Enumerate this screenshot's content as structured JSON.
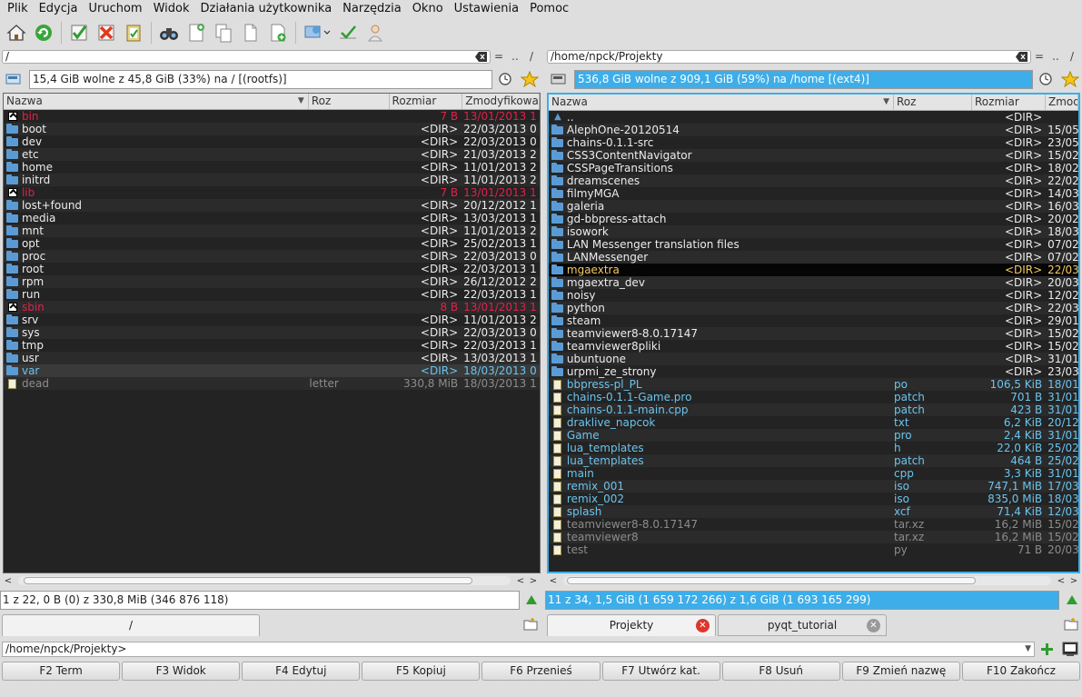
{
  "menu": [
    "Plik",
    "Edycja",
    "Uruchom",
    "Widok",
    "Działania użytkownika",
    "Narzędzia",
    "Okno",
    "Ustawienia",
    "Pomoc"
  ],
  "left": {
    "path": "/",
    "nav_up": "..",
    "nav_root": "/",
    "eq": "=",
    "info": "15,4 GiB wolne z 45,8 GiB (33%) na / [(rootfs)]",
    "headers": {
      "name": "Nazwa",
      "ext": "Roz",
      "size": "Rozmiar",
      "date": "Zmodyfikowa"
    },
    "rows": [
      {
        "name": "bin",
        "ext": "",
        "size": "7 B",
        "date": "13/01/2013 1",
        "kind": "link"
      },
      {
        "name": "boot",
        "ext": "",
        "size": "<DIR>",
        "date": "22/03/2013 0",
        "kind": "dir"
      },
      {
        "name": "dev",
        "ext": "",
        "size": "<DIR>",
        "date": "22/03/2013 0",
        "kind": "dir"
      },
      {
        "name": "etc",
        "ext": "",
        "size": "<DIR>",
        "date": "21/03/2013 2",
        "kind": "dir"
      },
      {
        "name": "home",
        "ext": "",
        "size": "<DIR>",
        "date": "11/01/2013 2",
        "kind": "dir"
      },
      {
        "name": "initrd",
        "ext": "",
        "size": "<DIR>",
        "date": "11/01/2013 2",
        "kind": "dir"
      },
      {
        "name": "lib",
        "ext": "",
        "size": "7 B",
        "date": "13/01/2013 1",
        "kind": "link"
      },
      {
        "name": "lost+found",
        "ext": "",
        "size": "<DIR>",
        "date": "20/12/2012 1",
        "kind": "dir"
      },
      {
        "name": "media",
        "ext": "",
        "size": "<DIR>",
        "date": "13/03/2013 1",
        "kind": "dir"
      },
      {
        "name": "mnt",
        "ext": "",
        "size": "<DIR>",
        "date": "11/01/2013 2",
        "kind": "dir"
      },
      {
        "name": "opt",
        "ext": "",
        "size": "<DIR>",
        "date": "25/02/2013 1",
        "kind": "dir"
      },
      {
        "name": "proc",
        "ext": "",
        "size": "<DIR>",
        "date": "22/03/2013 0",
        "kind": "dir"
      },
      {
        "name": "root",
        "ext": "",
        "size": "<DIR>",
        "date": "22/03/2013 1",
        "kind": "dir"
      },
      {
        "name": "rpm",
        "ext": "",
        "size": "<DIR>",
        "date": "26/12/2012 2",
        "kind": "dir"
      },
      {
        "name": "run",
        "ext": "",
        "size": "<DIR>",
        "date": "22/03/2013 1",
        "kind": "dir"
      },
      {
        "name": "sbin",
        "ext": "",
        "size": "8 B",
        "date": "13/01/2013 1",
        "kind": "link"
      },
      {
        "name": "srv",
        "ext": "",
        "size": "<DIR>",
        "date": "11/01/2013 2",
        "kind": "dir"
      },
      {
        "name": "sys",
        "ext": "",
        "size": "<DIR>",
        "date": "22/03/2013 0",
        "kind": "dir"
      },
      {
        "name": "tmp",
        "ext": "",
        "size": "<DIR>",
        "date": "22/03/2013 1",
        "kind": "dir"
      },
      {
        "name": "usr",
        "ext": "",
        "size": "<DIR>",
        "date": "13/03/2013 1",
        "kind": "dir"
      },
      {
        "name": "var",
        "ext": "",
        "size": "<DIR>",
        "date": "18/03/2013 0",
        "kind": "cursor"
      },
      {
        "name": "dead",
        "ext": "letter",
        "size": "330,8 MiB",
        "date": "18/03/2013 1",
        "kind": "dead"
      }
    ],
    "status": "1 z 22, 0 B (0) z 330,8 MiB (346 876 118)",
    "tabs": [
      {
        "label": "/"
      }
    ]
  },
  "right": {
    "path": "/home/npck/Projekty",
    "nav_up": "..",
    "nav_root": "/",
    "eq": "=",
    "info": "536,8 GiB wolne z 909,1 GiB (59%) na /home [(ext4)]",
    "headers": {
      "name": "Nazwa",
      "ext": "Roz",
      "size": "Rozmiar",
      "date": "Zmod"
    },
    "rows": [
      {
        "name": "..",
        "ext": "",
        "size": "<DIR>",
        "date": "",
        "kind": "up"
      },
      {
        "name": "AlephOne-20120514",
        "ext": "",
        "size": "<DIR>",
        "date": "15/05",
        "kind": "dir"
      },
      {
        "name": "chains-0.1.1-src",
        "ext": "",
        "size": "<DIR>",
        "date": "23/05",
        "kind": "dir"
      },
      {
        "name": "CSS3ContentNavigator",
        "ext": "",
        "size": "<DIR>",
        "date": "15/02",
        "kind": "dir"
      },
      {
        "name": "CSSPageTransitions",
        "ext": "",
        "size": "<DIR>",
        "date": "18/02",
        "kind": "dir"
      },
      {
        "name": "dreamscenes",
        "ext": "",
        "size": "<DIR>",
        "date": "22/02",
        "kind": "dir"
      },
      {
        "name": "filmyMGA",
        "ext": "",
        "size": "<DIR>",
        "date": "14/03",
        "kind": "dir"
      },
      {
        "name": "galeria",
        "ext": "",
        "size": "<DIR>",
        "date": "16/03",
        "kind": "dir"
      },
      {
        "name": "gd-bbpress-attach",
        "ext": "",
        "size": "<DIR>",
        "date": "20/02",
        "kind": "dir"
      },
      {
        "name": "isowork",
        "ext": "",
        "size": "<DIR>",
        "date": "18/03",
        "kind": "dir"
      },
      {
        "name": "LAN Messenger translation files",
        "ext": "",
        "size": "<DIR>",
        "date": "07/02",
        "kind": "dir"
      },
      {
        "name": "LANMessenger",
        "ext": "",
        "size": "<DIR>",
        "date": "07/02",
        "kind": "dir"
      },
      {
        "name": "mgaextra",
        "ext": "",
        "size": "<DIR>",
        "date": "22/03",
        "kind": "current"
      },
      {
        "name": "mgaextra_dev",
        "ext": "",
        "size": "<DIR>",
        "date": "20/03",
        "kind": "dir"
      },
      {
        "name": "noisy",
        "ext": "",
        "size": "<DIR>",
        "date": "12/02",
        "kind": "dir"
      },
      {
        "name": "python",
        "ext": "",
        "size": "<DIR>",
        "date": "22/03",
        "kind": "dir"
      },
      {
        "name": "steam",
        "ext": "",
        "size": "<DIR>",
        "date": "29/01",
        "kind": "dir"
      },
      {
        "name": "teamviewer8-8.0.17147",
        "ext": "",
        "size": "<DIR>",
        "date": "15/02",
        "kind": "dir"
      },
      {
        "name": "teamviewer8pliki",
        "ext": "",
        "size": "<DIR>",
        "date": "15/02",
        "kind": "dir"
      },
      {
        "name": "ubuntuone",
        "ext": "",
        "size": "<DIR>",
        "date": "31/01",
        "kind": "dir"
      },
      {
        "name": "urpmi_ze_strony",
        "ext": "",
        "size": "<DIR>",
        "date": "23/03",
        "kind": "dir"
      },
      {
        "name": "bbpress-pl_PL",
        "ext": "po",
        "size": "106,5 KiB",
        "date": "18/01",
        "kind": "file"
      },
      {
        "name": "chains-0.1.1-Game.pro",
        "ext": "patch",
        "size": "701 B",
        "date": "31/01",
        "kind": "file"
      },
      {
        "name": "chains-0.1.1-main.cpp",
        "ext": "patch",
        "size": "423 B",
        "date": "31/01",
        "kind": "file"
      },
      {
        "name": "draklive_napcok",
        "ext": "txt",
        "size": "6,2 KiB",
        "date": "20/12",
        "kind": "file"
      },
      {
        "name": "Game",
        "ext": "pro",
        "size": "2,4 KiB",
        "date": "31/01",
        "kind": "file"
      },
      {
        "name": "lua_templates",
        "ext": "h",
        "size": "22,0 KiB",
        "date": "25/02",
        "kind": "file"
      },
      {
        "name": "lua_templates",
        "ext": "patch",
        "size": "464 B",
        "date": "25/02",
        "kind": "file"
      },
      {
        "name": "main",
        "ext": "cpp",
        "size": "3,3 KiB",
        "date": "31/01",
        "kind": "file"
      },
      {
        "name": "remix_001",
        "ext": "iso",
        "size": "747,1 MiB",
        "date": "17/03",
        "kind": "file"
      },
      {
        "name": "remix_002",
        "ext": "iso",
        "size": "835,0 MiB",
        "date": "18/03",
        "kind": "file"
      },
      {
        "name": "splash",
        "ext": "xcf",
        "size": "71,4 KiB",
        "date": "12/03",
        "kind": "file"
      },
      {
        "name": "teamviewer8-8.0.17147",
        "ext": "tar.xz",
        "size": "16,2 MiB",
        "date": "15/02",
        "kind": "grey"
      },
      {
        "name": "teamviewer8",
        "ext": "tar.xz",
        "size": "16,2 MiB",
        "date": "15/02",
        "kind": "grey"
      },
      {
        "name": "test",
        "ext": "py",
        "size": "71 B",
        "date": "20/03",
        "kind": "grey"
      }
    ],
    "status": "11 z 34, 1,5 GiB (1 659 172 266) z 1,6 GiB (1 693 165 299)",
    "tabs": [
      {
        "label": "Projekty"
      },
      {
        "label": "pyqt_tutorial"
      }
    ]
  },
  "cmdline": "/home/npck/Projekty>",
  "fkeys": [
    "F2 Term",
    "F3 Widok",
    "F4 Edytuj",
    "F5 Kopiuj",
    "F6 Przenieś",
    "F7 Utwórz kat.",
    "F8 Usuń",
    "F9 Zmień nazwę",
    "F10 Zakończ"
  ],
  "colors": {
    "accent": "#3daee9",
    "link": "#e0214b",
    "file": "#6bc4ee",
    "current": "#f6c95c"
  }
}
